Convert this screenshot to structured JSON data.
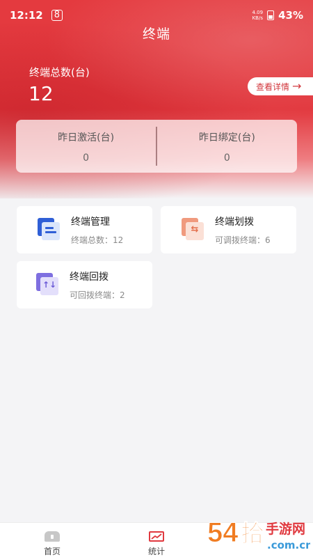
{
  "status_bar": {
    "time": "12:12",
    "sim_icon": "sim-card-icon",
    "net_speed_value": "4.09",
    "net_speed_unit": "KB/s",
    "battery": "43%"
  },
  "header": {
    "title": "终端"
  },
  "summary": {
    "total_label": "终端总数(台)",
    "total_value": "12",
    "detail_button": "查看详情",
    "yesterday_activated_label": "昨日激活(台)",
    "yesterday_activated_value": "0",
    "yesterday_bound_label": "昨日绑定(台)",
    "yesterday_bound_value": "0"
  },
  "cards": [
    {
      "name": "终端管理",
      "sub": "终端总数：12",
      "icon": "document-list-icon"
    },
    {
      "name": "终端划拨",
      "sub": "可调拨终端：6",
      "icon": "transfer-icon"
    },
    {
      "name": "终端回拨",
      "sub": "可回拨终端：2",
      "icon": "recall-icon"
    }
  ],
  "bottom_nav": {
    "items": [
      {
        "label": "首页",
        "icon": "home-icon"
      },
      {
        "label": "统计",
        "icon": "chart-icon"
      }
    ]
  },
  "watermark": {
    "line1": "54拾手游网",
    "line2": ".com.cn"
  },
  "colors": {
    "brand_red": "#e2383e",
    "blue_icon": "#2f5fd6",
    "orange_icon": "#f09a7e",
    "purple_icon": "#7e6fe0"
  }
}
